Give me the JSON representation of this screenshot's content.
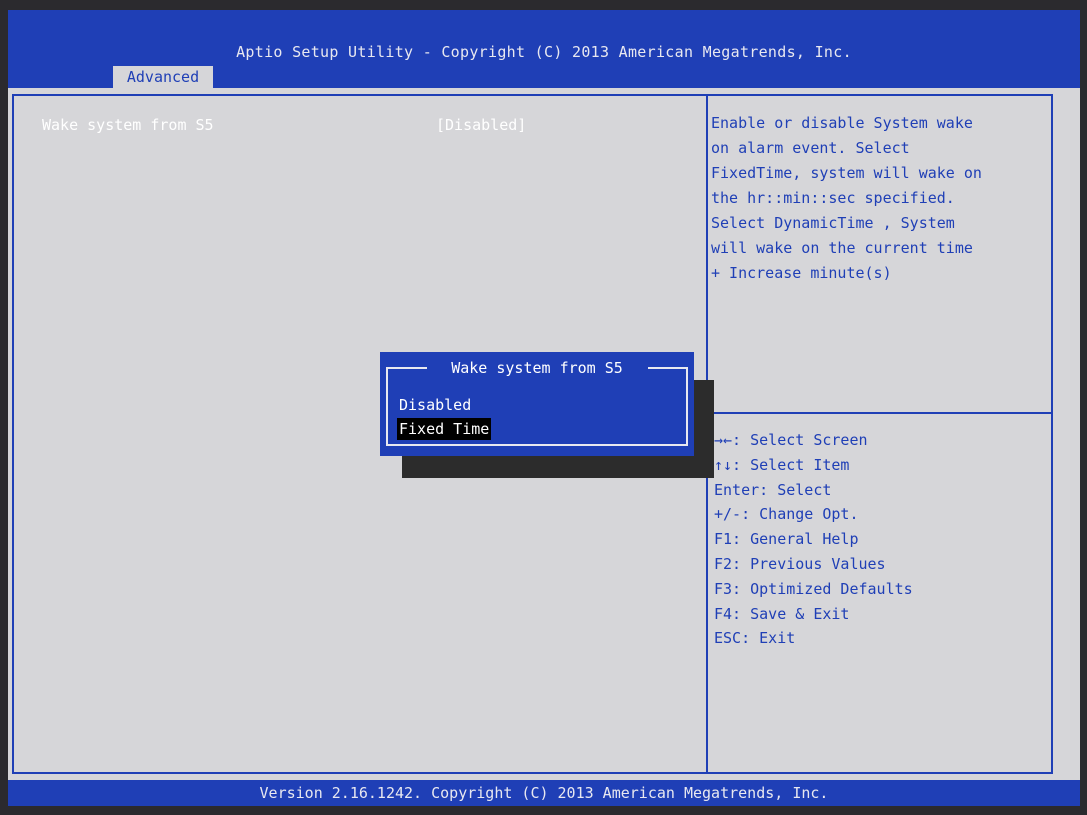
{
  "header": {
    "title": "Aptio Setup Utility - Copyright (C) 2013 American Megatrends, Inc.",
    "active_tab": "Advanced"
  },
  "main": {
    "setting": {
      "label": "Wake system from S5",
      "value": "[Disabled]"
    }
  },
  "help_panel": {
    "text": "Enable or disable System wake\non alarm event. Select\nFixedTime, system will wake on\nthe hr::min::sec specified.\nSelect DynamicTime , System\nwill wake on the current time\n+ Increase minute(s)"
  },
  "keys_panel": {
    "items": [
      "→←: Select Screen",
      "↑↓: Select Item",
      "Enter: Select",
      "+/-: Change Opt.",
      "F1: General Help",
      "F2: Previous Values",
      "F3: Optimized Defaults",
      "F4: Save & Exit",
      "ESC: Exit"
    ]
  },
  "popup": {
    "title": "Wake system from S5",
    "options": [
      "Disabled",
      "Fixed Time"
    ],
    "selected_index": 1
  },
  "footer": {
    "text": "Version 2.16.1242. Copyright (C) 2013 American Megatrends, Inc."
  },
  "colors": {
    "bios_blue": "#1f3fb6",
    "bios_gray": "#d6d6d9",
    "highlight": "#000000",
    "text_white": "#ffffff"
  }
}
